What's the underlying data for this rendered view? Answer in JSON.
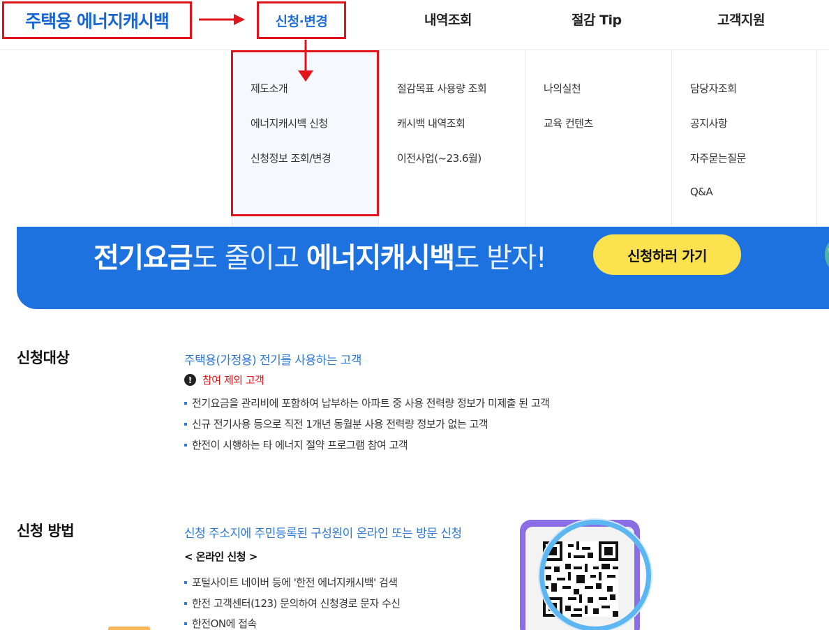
{
  "header": {
    "logo": "주택용 에너지캐시백",
    "nav": [
      {
        "label": "신청·변경",
        "active": true
      },
      {
        "label": "내역조회",
        "active": false
      },
      {
        "label": "절감 Tip",
        "active": false
      },
      {
        "label": "고객지원",
        "active": false
      }
    ]
  },
  "mega_menu": {
    "columns": [
      {
        "items": [
          "제도소개",
          "에너지캐시백 신청",
          "신청정보 조회/변경"
        ]
      },
      {
        "items": [
          "절감목표 사용량 조회",
          "캐시백 내역조회",
          "이전사업(~23.6월)"
        ]
      },
      {
        "items": [
          "나의실천",
          "교육 컨텐츠"
        ]
      },
      {
        "items": [
          "담당자조회",
          "공지사항",
          "자주묻는질문",
          "Q&A"
        ]
      }
    ]
  },
  "banner": {
    "part1_bold": "전기요금",
    "part2": "도 줄이고 ",
    "part3_bold": "에너지캐시백",
    "part4": "도 받자!",
    "button": "신청하러 가기"
  },
  "target_section": {
    "title": "신청대상",
    "lead": "주택용(가정용) 전기를 사용하는 고객",
    "exclusion_label": "참여 제외 고객",
    "exclusions": [
      "전기요금을 관리비에 포함하여 납부하는 아파트 중 사용 전력량 정보가 미제출 된 고객",
      "신규 전기사용 등으로 직전 1개년 동월분 사용 전력량 정보가 없는 고객",
      "한전이 시행하는 타 에너지 절약 프로그램 참여 고객"
    ]
  },
  "method_section": {
    "title": "신청 방법",
    "lead": "신청 주소지에 주민등록된 구성원이 온라인 또는 방문 신청",
    "online_head": "< 온라인 신청 >",
    "steps": [
      "포털사이트 네이버 등에 '한전 에너지캐시백' 검색",
      "한전 고객센터(123) 문의하여 신청경로 문자 수신",
      "한전ON에 접속"
    ]
  },
  "colors": {
    "brand_blue": "#1d72e0",
    "accent_red": "#e1141b",
    "button_yellow": "#fde24f",
    "link_blue": "#2f7ad6"
  },
  "icons": [
    "arrow-right-icon",
    "arrow-down-icon",
    "exclamation-icon",
    "qr-code-icon",
    "globe-icon"
  ]
}
